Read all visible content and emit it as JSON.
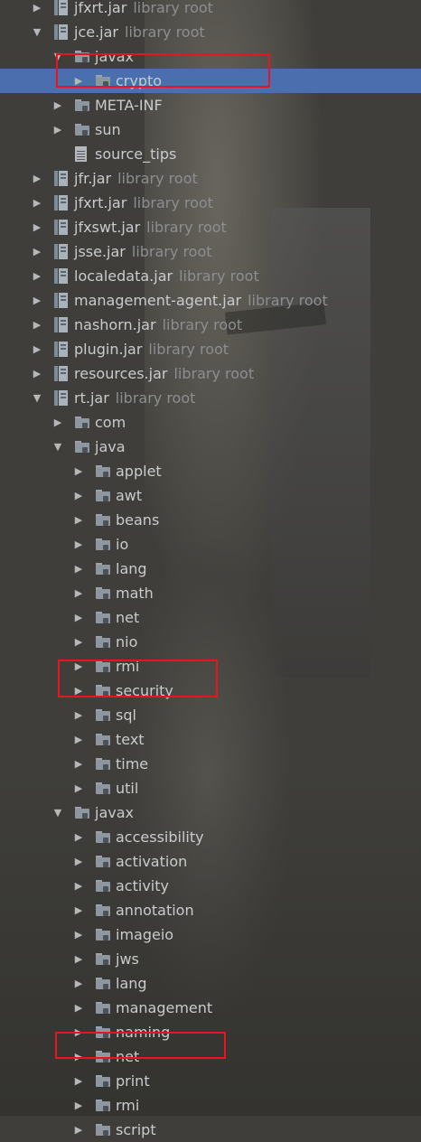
{
  "tree": {
    "rows": [
      {
        "name": "jar-rt-prev",
        "label": "jfxrt.jar",
        "suffix": "library root",
        "kind": "jar",
        "expanded": false,
        "selected": false
      },
      {
        "name": "jar-jce",
        "label": "jce.jar",
        "suffix": "library root",
        "kind": "jar",
        "expanded": true,
        "selected": false
      },
      {
        "name": "pkg-jce-javax",
        "label": "javax",
        "suffix": "",
        "kind": "package",
        "expanded": true,
        "selected": false
      },
      {
        "name": "pkg-crypto",
        "label": "crypto",
        "suffix": "",
        "kind": "package",
        "expanded": false,
        "selected": true
      },
      {
        "name": "pkg-meta-inf",
        "label": "META-INF",
        "suffix": "",
        "kind": "package",
        "expanded": false,
        "selected": false
      },
      {
        "name": "pkg-sun",
        "label": "sun",
        "suffix": "",
        "kind": "package",
        "expanded": false,
        "selected": false
      },
      {
        "name": "file-source-tips",
        "label": "source_tips",
        "suffix": "",
        "kind": "file",
        "expanded": null,
        "selected": false
      },
      {
        "name": "jar-jfr",
        "label": "jfr.jar",
        "suffix": "library root",
        "kind": "jar",
        "expanded": false,
        "selected": false
      },
      {
        "name": "jar-jfxrt",
        "label": "jfxrt.jar",
        "suffix": "library root",
        "kind": "jar",
        "expanded": false,
        "selected": false
      },
      {
        "name": "jar-jfxswt",
        "label": "jfxswt.jar",
        "suffix": "library root",
        "kind": "jar",
        "expanded": false,
        "selected": false
      },
      {
        "name": "jar-jsse",
        "label": "jsse.jar",
        "suffix": "library root",
        "kind": "jar",
        "expanded": false,
        "selected": false
      },
      {
        "name": "jar-localedata",
        "label": "localedata.jar",
        "suffix": "library root",
        "kind": "jar",
        "expanded": false,
        "selected": false
      },
      {
        "name": "jar-management-agent",
        "label": "management-agent.jar",
        "suffix": "library root",
        "kind": "jar",
        "expanded": false,
        "selected": false
      },
      {
        "name": "jar-nashorn",
        "label": "nashorn.jar",
        "suffix": "library root",
        "kind": "jar",
        "expanded": false,
        "selected": false
      },
      {
        "name": "jar-plugin",
        "label": "plugin.jar",
        "suffix": "library root",
        "kind": "jar",
        "expanded": false,
        "selected": false
      },
      {
        "name": "jar-resources",
        "label": "resources.jar",
        "suffix": "library root",
        "kind": "jar",
        "expanded": false,
        "selected": false
      },
      {
        "name": "jar-rt",
        "label": "rt.jar",
        "suffix": "library root",
        "kind": "jar",
        "expanded": true,
        "selected": false
      },
      {
        "name": "pkg-com",
        "label": "com",
        "suffix": "",
        "kind": "package",
        "expanded": false,
        "selected": false
      },
      {
        "name": "pkg-java",
        "label": "java",
        "suffix": "",
        "kind": "package",
        "expanded": true,
        "selected": false
      },
      {
        "name": "pkg-applet",
        "label": "applet",
        "suffix": "",
        "kind": "package",
        "expanded": false,
        "selected": false
      },
      {
        "name": "pkg-awt",
        "label": "awt",
        "suffix": "",
        "kind": "package",
        "expanded": false,
        "selected": false
      },
      {
        "name": "pkg-beans",
        "label": "beans",
        "suffix": "",
        "kind": "package",
        "expanded": false,
        "selected": false
      },
      {
        "name": "pkg-io",
        "label": "io",
        "suffix": "",
        "kind": "package",
        "expanded": false,
        "selected": false
      },
      {
        "name": "pkg-lang",
        "label": "lang",
        "suffix": "",
        "kind": "package",
        "expanded": false,
        "selected": false
      },
      {
        "name": "pkg-math",
        "label": "math",
        "suffix": "",
        "kind": "package",
        "expanded": false,
        "selected": false
      },
      {
        "name": "pkg-net",
        "label": "net",
        "suffix": "",
        "kind": "package",
        "expanded": false,
        "selected": false
      },
      {
        "name": "pkg-nio",
        "label": "nio",
        "suffix": "",
        "kind": "package",
        "expanded": false,
        "selected": false
      },
      {
        "name": "pkg-rmi",
        "label": "rmi",
        "suffix": "",
        "kind": "package",
        "expanded": false,
        "selected": false
      },
      {
        "name": "pkg-security",
        "label": "security",
        "suffix": "",
        "kind": "package",
        "expanded": false,
        "selected": false
      },
      {
        "name": "pkg-sql",
        "label": "sql",
        "suffix": "",
        "kind": "package",
        "expanded": false,
        "selected": false
      },
      {
        "name": "pkg-text",
        "label": "text",
        "suffix": "",
        "kind": "package",
        "expanded": false,
        "selected": false
      },
      {
        "name": "pkg-time",
        "label": "time",
        "suffix": "",
        "kind": "package",
        "expanded": false,
        "selected": false
      },
      {
        "name": "pkg-util",
        "label": "util",
        "suffix": "",
        "kind": "package",
        "expanded": false,
        "selected": false
      },
      {
        "name": "pkg-rt-javax",
        "label": "javax",
        "suffix": "",
        "kind": "package",
        "expanded": true,
        "selected": false
      },
      {
        "name": "pkg-accessibility",
        "label": "accessibility",
        "suffix": "",
        "kind": "package",
        "expanded": false,
        "selected": false
      },
      {
        "name": "pkg-activation",
        "label": "activation",
        "suffix": "",
        "kind": "package",
        "expanded": false,
        "selected": false
      },
      {
        "name": "pkg-activity",
        "label": "activity",
        "suffix": "",
        "kind": "package",
        "expanded": false,
        "selected": false
      },
      {
        "name": "pkg-annotation",
        "label": "annotation",
        "suffix": "",
        "kind": "package",
        "expanded": false,
        "selected": false
      },
      {
        "name": "pkg-imageio",
        "label": "imageio",
        "suffix": "",
        "kind": "package",
        "expanded": false,
        "selected": false
      },
      {
        "name": "pkg-jws",
        "label": "jws",
        "suffix": "",
        "kind": "package",
        "expanded": false,
        "selected": false
      },
      {
        "name": "pkg-javax-lang",
        "label": "lang",
        "suffix": "",
        "kind": "package",
        "expanded": false,
        "selected": false
      },
      {
        "name": "pkg-management",
        "label": "management",
        "suffix": "",
        "kind": "package",
        "expanded": false,
        "selected": false
      },
      {
        "name": "pkg-naming",
        "label": "naming",
        "suffix": "",
        "kind": "package",
        "expanded": false,
        "selected": false
      },
      {
        "name": "pkg-javax-net",
        "label": "net",
        "suffix": "",
        "kind": "package",
        "expanded": false,
        "selected": false
      },
      {
        "name": "pkg-print",
        "label": "print",
        "suffix": "",
        "kind": "package",
        "expanded": false,
        "selected": false
      },
      {
        "name": "pkg-javax-rmi",
        "label": "rmi",
        "suffix": "",
        "kind": "package",
        "expanded": false,
        "selected": false
      },
      {
        "name": "pkg-script",
        "label": "script",
        "suffix": "",
        "kind": "package",
        "expanded": false,
        "selected": false
      }
    ]
  },
  "colors": {
    "selection": "#4b6eaf",
    "highlight_box": "#e8141e",
    "text": "#c9cbcd",
    "suffix_text": "#8c8e90"
  },
  "icons": {
    "package": "package-folder-icon",
    "jar": "jar-archive-icon",
    "file": "text-file-icon",
    "expanded": "triangle-down-icon",
    "collapsed": "triangle-right-icon"
  }
}
